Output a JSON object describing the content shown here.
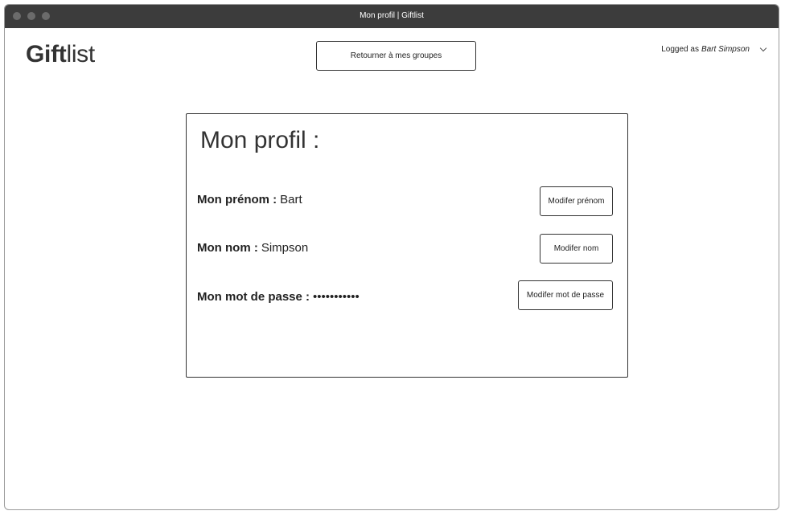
{
  "window": {
    "title": "Mon profil | Giftlist"
  },
  "header": {
    "logo_bold": "Gift",
    "logo_light": "list",
    "back_button_label": "Retourner à mes groupes",
    "user_prefix": "Logged as",
    "user_name": "Bart Simpson"
  },
  "profile": {
    "title": "Mon profil :",
    "fields": [
      {
        "label": "Mon prénom :",
        "value": "Bart",
        "button_label": "Modifer prénom"
      },
      {
        "label": "Mon nom :",
        "value": "Simpson",
        "button_label": "Modifer nom"
      },
      {
        "label": "Mon mot de passe :",
        "value": "•••••••••••",
        "button_label": "Modifer mot de passe"
      }
    ]
  },
  "icons": {
    "user_menu": "chevron-down-icon"
  }
}
